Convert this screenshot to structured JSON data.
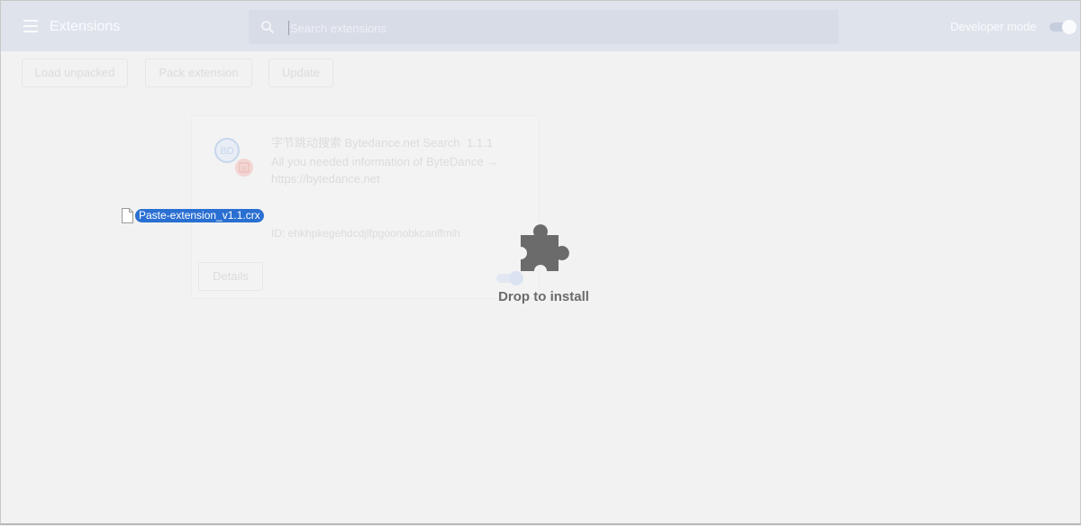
{
  "header": {
    "title": "Extensions",
    "search_placeholder": "Search extensions",
    "developer_mode_label": "Developer mode",
    "developer_mode_on": true
  },
  "toolbar": {
    "load_unpacked": "Load unpacked",
    "pack_extension": "Pack extension",
    "update": "Update"
  },
  "extension_card": {
    "name": "字节跳动搜索 Bytedance.net Search",
    "version": "1.1.1",
    "description": "All you needed information of ByteDance → https://bytedance.net",
    "id_text": "ID: ehkhpkegehdcdjlfpgoonobkcanffmih",
    "details_label": "Details",
    "enabled": true,
    "logo_text": "BD",
    "badge_text": "B"
  },
  "drag": {
    "file_name": "Paste-extension_v1.1.crx"
  },
  "drop_overlay": {
    "label": "Drop to install",
    "icon": "puzzle-icon"
  },
  "colors": {
    "header_bg": "#dfe3ec",
    "page_bg": "#f2f2f2",
    "drag_highlight": "#2a6fd2",
    "drop_icon": "#6b6b6b"
  }
}
